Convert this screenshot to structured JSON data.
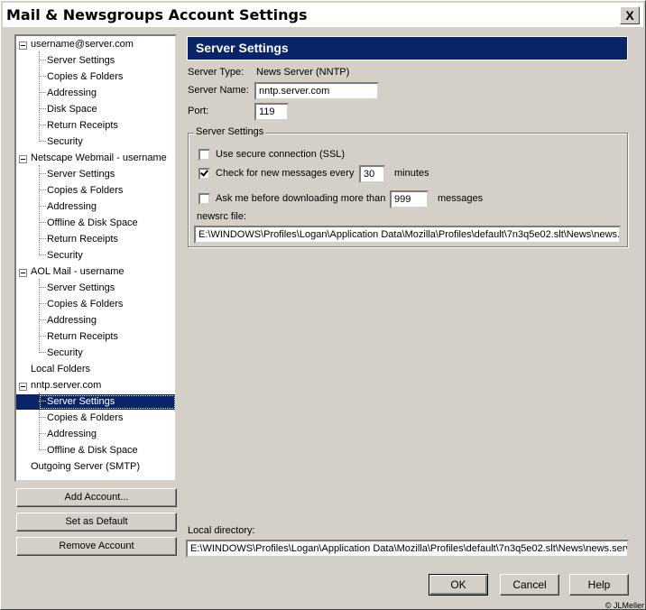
{
  "window": {
    "title": "Mail & Newsgroups Account Settings",
    "close_label": "X"
  },
  "tree": {
    "accounts": [
      {
        "name": "username@server.com",
        "children": [
          "Server Settings",
          "Copies & Folders",
          "Addressing",
          "Disk Space",
          "Return Receipts",
          "Security"
        ]
      },
      {
        "name": "Netscape Webmail - username",
        "children": [
          "Server Settings",
          "Copies & Folders",
          "Addressing",
          "Offline & Disk Space",
          "Return Receipts",
          "Security"
        ]
      },
      {
        "name": "AOL Mail - username",
        "children": [
          "Server Settings",
          "Copies & Folders",
          "Addressing",
          "Return Receipts",
          "Security"
        ]
      },
      {
        "name": "Local Folders"
      },
      {
        "name": "nntp.server.com",
        "children": [
          "Server Settings",
          "Copies & Folders",
          "Addressing",
          "Offline & Disk Space"
        ]
      },
      {
        "name": "Outgoing Server (SMTP)"
      }
    ],
    "selected": "nntp.server.com / Server Settings"
  },
  "left_buttons": {
    "add_account": "Add Account...",
    "set_default": "Set as Default",
    "remove_account": "Remove Account"
  },
  "panel": {
    "title": "Server Settings",
    "server_type_label": "Server Type:",
    "server_type_value": "News Server (NNTP)",
    "server_name_label": "Server Name:",
    "server_name_value": "nntp.server.com",
    "port_label": "Port:",
    "port_value": "119",
    "group_label": "Server Settings",
    "ssl_label": "Use secure connection (SSL)",
    "ssl_checked": false,
    "check_new_label": "Check for new messages every",
    "check_new_checked": true,
    "check_interval": "30",
    "minutes_label": "minutes",
    "ask_before_label": "Ask me before downloading more than",
    "ask_before_checked": false,
    "ask_count": "999",
    "messages_label": "messages",
    "newsrc_label": "newsrc file:",
    "newsrc_value": "E:\\WINDOWS\\Profiles\\Logan\\Application Data\\Mozilla\\Profiles\\default\\7n3q5e02.slt\\News\\news.server.com",
    "local_dir_label": "Local directory:",
    "local_dir_value": "E:\\WINDOWS\\Profiles\\Logan\\Application Data\\Mozilla\\Profiles\\default\\7n3q5e02.slt\\News\\news.server.com"
  },
  "dialog_buttons": {
    "ok": "OK",
    "cancel": "Cancel",
    "help": "Help"
  },
  "copyright": "© JLMeller"
}
